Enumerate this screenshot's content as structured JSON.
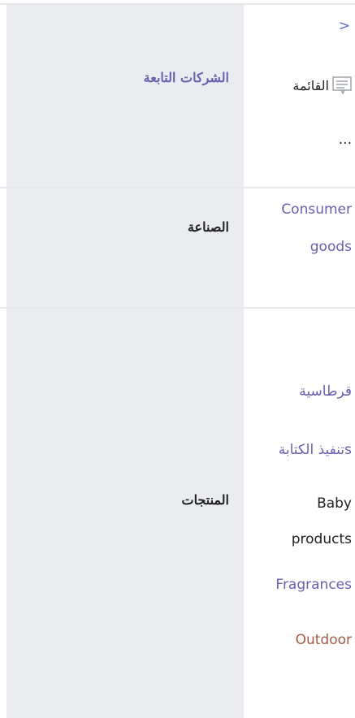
{
  "subsidiaries": {
    "label": "الشركات التابعة",
    "arrow": ">",
    "list_label": "القائمة",
    "icon": "list-icon",
    "more": "..."
  },
  "industry": {
    "label": "الصناعة",
    "value_line1": "Consumer",
    "value_line2": "goods"
  },
  "products": {
    "label": "المنتجات",
    "items": [
      "قرطاسية",
      "تنفيذ الكتابةs",
      "Baby",
      "products",
      "Fragrances",
      "Outdoor"
    ]
  },
  "colors": {
    "label_background": "#eaecf0",
    "link": "#6a5fb0",
    "external_link": "#a15a44",
    "text": "#202122"
  }
}
